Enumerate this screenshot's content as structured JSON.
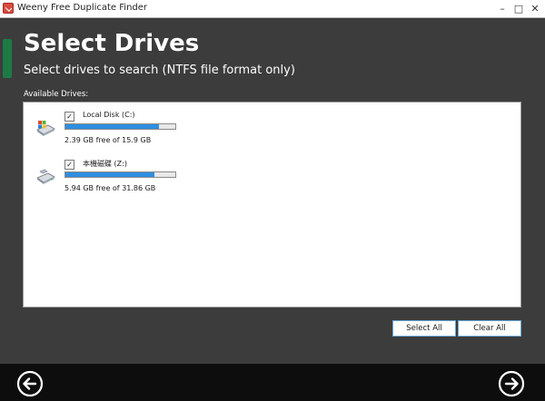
{
  "window": {
    "title": "Weeny Free Duplicate Finder",
    "controls": {
      "minimize": "–",
      "maximize": "□",
      "close": "✕"
    }
  },
  "header": {
    "title": "Select Drives",
    "subtitle": "Select drives to search (NTFS file format only)"
  },
  "drives": {
    "label": "Available Drives:",
    "items": [
      {
        "name": "Local Disk (C:)",
        "checked": true,
        "free_text": "2.39 GB free of 15.9 GB",
        "used_fraction": 0.85,
        "icon": "windows-drive-icon"
      },
      {
        "name": "本機磁碟 (Z:)",
        "checked": true,
        "free_text": "5.94 GB free of 31.86 GB",
        "used_fraction": 0.81,
        "icon": "hard-drive-icon"
      }
    ]
  },
  "buttons": {
    "select_all": "Select All",
    "clear_all": "Clear All"
  },
  "nav": {
    "back_icon": "back-arrow-icon",
    "next_icon": "next-arrow-icon"
  },
  "colors": {
    "background": "#3c3c3c",
    "accent": "#1e7a44",
    "bar_fill": "#2f8ee0",
    "bottom_bar": "#0d0d0d"
  }
}
